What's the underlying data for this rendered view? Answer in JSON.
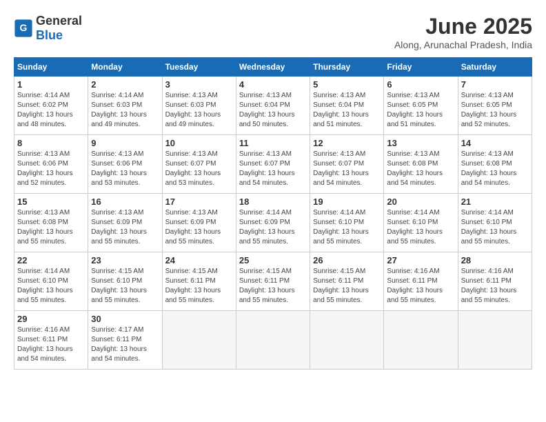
{
  "header": {
    "logo_general": "General",
    "logo_blue": "Blue",
    "month_year": "June 2025",
    "location": "Along, Arunachal Pradesh, India"
  },
  "columns": [
    "Sunday",
    "Monday",
    "Tuesday",
    "Wednesday",
    "Thursday",
    "Friday",
    "Saturday"
  ],
  "weeks": [
    [
      {
        "day": "1",
        "info": "Sunrise: 4:14 AM\nSunset: 6:02 PM\nDaylight: 13 hours and 48 minutes."
      },
      {
        "day": "2",
        "info": "Sunrise: 4:14 AM\nSunset: 6:03 PM\nDaylight: 13 hours and 49 minutes."
      },
      {
        "day": "3",
        "info": "Sunrise: 4:13 AM\nSunset: 6:03 PM\nDaylight: 13 hours and 49 minutes."
      },
      {
        "day": "4",
        "info": "Sunrise: 4:13 AM\nSunset: 6:04 PM\nDaylight: 13 hours and 50 minutes."
      },
      {
        "day": "5",
        "info": "Sunrise: 4:13 AM\nSunset: 6:04 PM\nDaylight: 13 hours and 51 minutes."
      },
      {
        "day": "6",
        "info": "Sunrise: 4:13 AM\nSunset: 6:05 PM\nDaylight: 13 hours and 51 minutes."
      },
      {
        "day": "7",
        "info": "Sunrise: 4:13 AM\nSunset: 6:05 PM\nDaylight: 13 hours and 52 minutes."
      }
    ],
    [
      {
        "day": "8",
        "info": "Sunrise: 4:13 AM\nSunset: 6:06 PM\nDaylight: 13 hours and 52 minutes."
      },
      {
        "day": "9",
        "info": "Sunrise: 4:13 AM\nSunset: 6:06 PM\nDaylight: 13 hours and 53 minutes."
      },
      {
        "day": "10",
        "info": "Sunrise: 4:13 AM\nSunset: 6:07 PM\nDaylight: 13 hours and 53 minutes."
      },
      {
        "day": "11",
        "info": "Sunrise: 4:13 AM\nSunset: 6:07 PM\nDaylight: 13 hours and 54 minutes."
      },
      {
        "day": "12",
        "info": "Sunrise: 4:13 AM\nSunset: 6:07 PM\nDaylight: 13 hours and 54 minutes."
      },
      {
        "day": "13",
        "info": "Sunrise: 4:13 AM\nSunset: 6:08 PM\nDaylight: 13 hours and 54 minutes."
      },
      {
        "day": "14",
        "info": "Sunrise: 4:13 AM\nSunset: 6:08 PM\nDaylight: 13 hours and 54 minutes."
      }
    ],
    [
      {
        "day": "15",
        "info": "Sunrise: 4:13 AM\nSunset: 6:08 PM\nDaylight: 13 hours and 55 minutes."
      },
      {
        "day": "16",
        "info": "Sunrise: 4:13 AM\nSunset: 6:09 PM\nDaylight: 13 hours and 55 minutes."
      },
      {
        "day": "17",
        "info": "Sunrise: 4:13 AM\nSunset: 6:09 PM\nDaylight: 13 hours and 55 minutes."
      },
      {
        "day": "18",
        "info": "Sunrise: 4:14 AM\nSunset: 6:09 PM\nDaylight: 13 hours and 55 minutes."
      },
      {
        "day": "19",
        "info": "Sunrise: 4:14 AM\nSunset: 6:10 PM\nDaylight: 13 hours and 55 minutes."
      },
      {
        "day": "20",
        "info": "Sunrise: 4:14 AM\nSunset: 6:10 PM\nDaylight: 13 hours and 55 minutes."
      },
      {
        "day": "21",
        "info": "Sunrise: 4:14 AM\nSunset: 6:10 PM\nDaylight: 13 hours and 55 minutes."
      }
    ],
    [
      {
        "day": "22",
        "info": "Sunrise: 4:14 AM\nSunset: 6:10 PM\nDaylight: 13 hours and 55 minutes."
      },
      {
        "day": "23",
        "info": "Sunrise: 4:15 AM\nSunset: 6:10 PM\nDaylight: 13 hours and 55 minutes."
      },
      {
        "day": "24",
        "info": "Sunrise: 4:15 AM\nSunset: 6:11 PM\nDaylight: 13 hours and 55 minutes."
      },
      {
        "day": "25",
        "info": "Sunrise: 4:15 AM\nSunset: 6:11 PM\nDaylight: 13 hours and 55 minutes."
      },
      {
        "day": "26",
        "info": "Sunrise: 4:15 AM\nSunset: 6:11 PM\nDaylight: 13 hours and 55 minutes."
      },
      {
        "day": "27",
        "info": "Sunrise: 4:16 AM\nSunset: 6:11 PM\nDaylight: 13 hours and 55 minutes."
      },
      {
        "day": "28",
        "info": "Sunrise: 4:16 AM\nSunset: 6:11 PM\nDaylight: 13 hours and 55 minutes."
      }
    ],
    [
      {
        "day": "29",
        "info": "Sunrise: 4:16 AM\nSunset: 6:11 PM\nDaylight: 13 hours and 54 minutes."
      },
      {
        "day": "30",
        "info": "Sunrise: 4:17 AM\nSunset: 6:11 PM\nDaylight: 13 hours and 54 minutes."
      },
      {
        "day": "",
        "info": ""
      },
      {
        "day": "",
        "info": ""
      },
      {
        "day": "",
        "info": ""
      },
      {
        "day": "",
        "info": ""
      },
      {
        "day": "",
        "info": ""
      }
    ]
  ]
}
